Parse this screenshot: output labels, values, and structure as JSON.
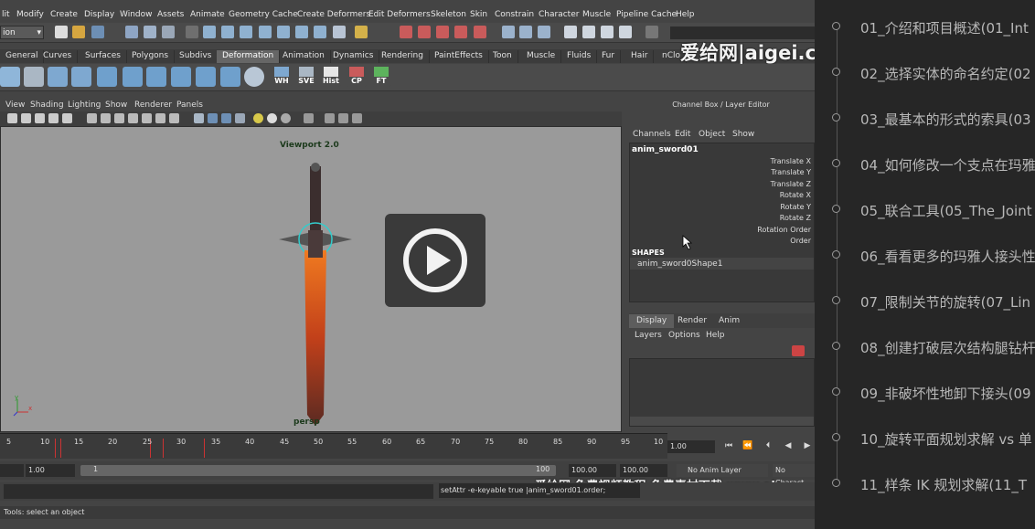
{
  "menubar": {
    "items": [
      "lit",
      "Modify",
      "Create",
      "Display",
      "Window",
      "Assets",
      "Animate",
      "Geometry Cache",
      "Create Deformers",
      "Edit Deformers",
      "Skeleton",
      "Skin",
      "Constrain",
      "Character",
      "Muscle",
      "Pipeline Cache",
      "Help"
    ]
  },
  "statusline": {
    "mode": "ion"
  },
  "shelf": {
    "tabs": [
      "General",
      "Curves",
      "Surfaces",
      "Polygons",
      "Subdivs",
      "Deformation",
      "Animation",
      "Dynamics",
      "Rendering",
      "PaintEffects",
      "Toon",
      "Muscle",
      "Fluids",
      "Fur",
      "Hair",
      "nClo"
    ],
    "active_tab": "Deformation",
    "text_icons": [
      "WH",
      "SVE",
      "Hist",
      "CP",
      "FT"
    ]
  },
  "panel": {
    "menus": [
      "View",
      "Shading",
      "Lighting",
      "Show",
      "Renderer",
      "Panels"
    ],
    "viewport_title": "Viewport 2.0",
    "camera": "persp"
  },
  "channel_box": {
    "title": "Channel Box / Layer Editor",
    "menus": [
      "Channels",
      "Edit",
      "Object",
      "Show"
    ],
    "object": "anim_sword01",
    "attributes": [
      "Translate X",
      "Translate Y",
      "Translate Z",
      "Rotate X",
      "Rotate Y",
      "Rotate Z",
      "Rotation Order",
      "Order"
    ],
    "shapes_header": "SHAPES",
    "shape_name": "anim_sword0Shape1"
  },
  "layer_editor": {
    "tabs": [
      "Display",
      "Render",
      "Anim"
    ],
    "active_tab": "Display",
    "menus": [
      "Layers",
      "Options",
      "Help"
    ]
  },
  "timeline": {
    "ticks": [
      "5",
      "10",
      "15",
      "20",
      "25",
      "30",
      "35",
      "40",
      "45",
      "50",
      "55",
      "60",
      "65",
      "70",
      "75",
      "80",
      "85",
      "90",
      "95",
      "10"
    ],
    "current_frame": "1.00"
  },
  "range": {
    "start": "1.00",
    "slider_start": "1",
    "slider_end": "100",
    "end1": "100.00",
    "end2": "100.00",
    "anim_layer": "No Anim Layer",
    "character": "No Charact"
  },
  "command": {
    "output": "setAttr -e-keyable true |anim_sword01.order;"
  },
  "helpline": "Tools: select an object",
  "watermarks": {
    "top": "爱给网|aigei.c",
    "bottom": "爱给网   免费视频教程-免费素材下载   www.aig"
  },
  "playlist": [
    "01_介绍和项目概述(01_Int",
    "02_选择实体的命名约定(02",
    "03_最基本的形式的索具(03",
    "04_如何修改一个支点在玛雅",
    "05_联合工具(05_The_Joint",
    "06_看看更多的玛雅人接头性",
    "07_限制关节的旋转(07_Lin",
    "08_创建打破层次结构腿钻杆",
    "09_非破坏性地卸下接头(09",
    "10_旋转平面规划求解 vs 单",
    "11_样条 IK 规划求解(11_T"
  ],
  "colors": {
    "accent_tab": "#666666",
    "viewport_bg": "#9a9a9a",
    "playlist_bg": "#262626"
  }
}
